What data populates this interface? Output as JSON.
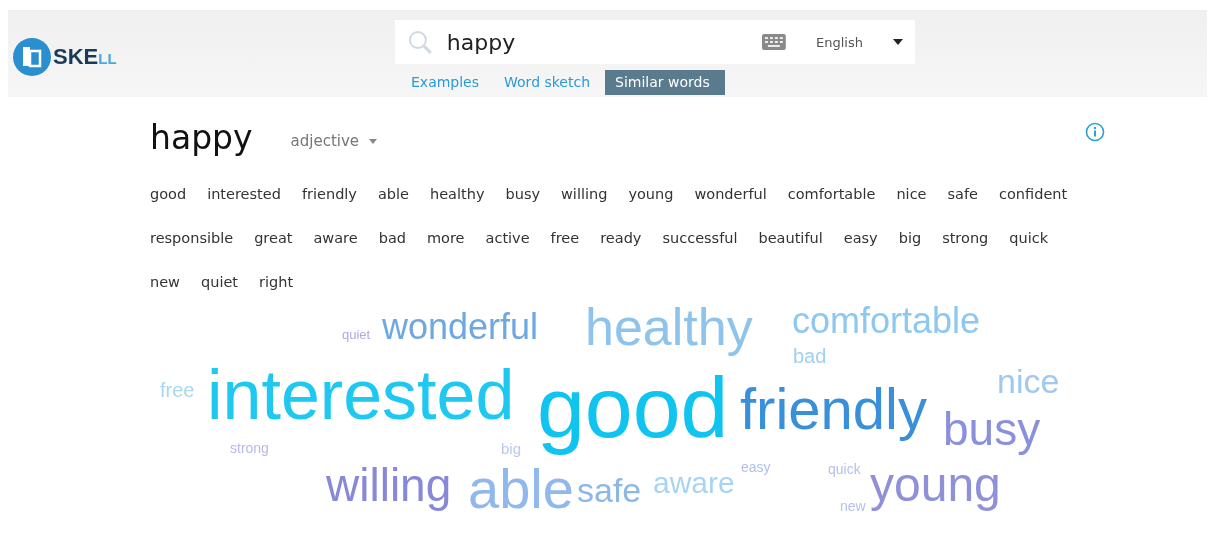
{
  "logo": {
    "text": "SKE",
    "suffix": "LL"
  },
  "search": {
    "value": "happy",
    "language": "English"
  },
  "tabs": [
    {
      "label": "Examples",
      "selected": false
    },
    {
      "label": "Word sketch",
      "selected": false
    },
    {
      "label": "Similar words",
      "selected": true
    }
  ],
  "headword": "happy",
  "part_of_speech": "adjective",
  "similar_words": [
    "good",
    "interested",
    "friendly",
    "able",
    "healthy",
    "busy",
    "willing",
    "young",
    "wonderful",
    "comfortable",
    "nice",
    "safe",
    "confident",
    "responsible",
    "great",
    "aware",
    "bad",
    "more",
    "active",
    "free",
    "ready",
    "successful",
    "beautiful",
    "easy",
    "big",
    "strong",
    "quick",
    "new",
    "quiet",
    "right"
  ],
  "word_cloud": [
    {
      "text": "quiet",
      "color": "#b0a8e0"
    },
    {
      "text": "wonderful",
      "color": "#6fa8e0"
    },
    {
      "text": "healthy",
      "color": "#8ec4ec"
    },
    {
      "text": "comfortable",
      "color": "#8cc8f0"
    },
    {
      "text": "bad",
      "color": "#a0d0f0"
    },
    {
      "text": "free",
      "color": "#a8d8f0"
    },
    {
      "text": "interested",
      "color": "#1ec8f0"
    },
    {
      "text": "strong",
      "color": "#b8b8e8"
    },
    {
      "text": "big",
      "color": "#b8c8f0"
    },
    {
      "text": "good",
      "color": "#10c4f0"
    },
    {
      "text": "friendly",
      "color": "#3a90d8"
    },
    {
      "text": "nice",
      "color": "#a0c8f0"
    },
    {
      "text": "busy",
      "color": "#8a90dc"
    },
    {
      "text": "willing",
      "color": "#8888d8"
    },
    {
      "text": "able",
      "color": "#90b8ec"
    },
    {
      "text": "safe",
      "color": "#8ab8e8"
    },
    {
      "text": "aware",
      "color": "#a8d4f4"
    },
    {
      "text": "easy",
      "color": "#b0c0f0"
    },
    {
      "text": "quick",
      "color": "#b8c0ec"
    },
    {
      "text": "new",
      "color": "#b8c0ec"
    },
    {
      "text": "young",
      "color": "#9090d8"
    }
  ]
}
